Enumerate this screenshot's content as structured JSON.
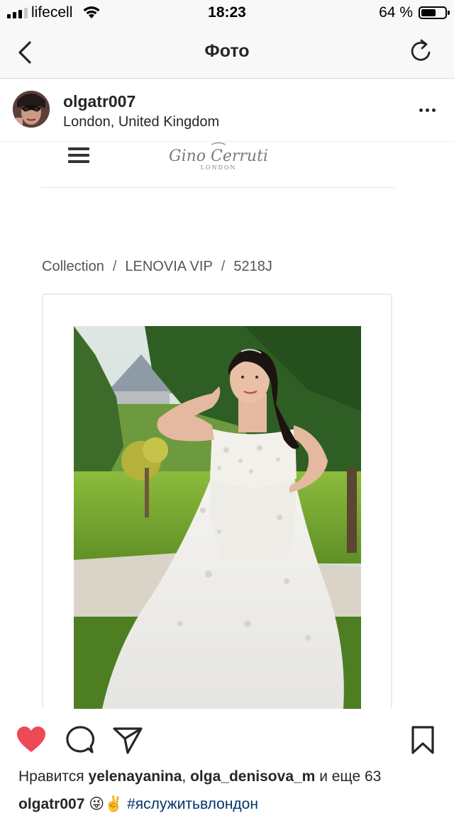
{
  "status_bar": {
    "carrier": "lifecell",
    "time": "18:23",
    "battery_percent": "64 %",
    "battery_level": 0.64,
    "signal_bars_active": 3,
    "signal_bars_total": 4
  },
  "nav": {
    "title": "Фото",
    "back_icon": "chevron-left-icon",
    "refresh_icon": "refresh-icon"
  },
  "post": {
    "username": "olgatr007",
    "location": "London, United Kingdom",
    "more_icon": "more-horizontal-icon"
  },
  "photo_content": {
    "logo_text": "Gino Cerruti",
    "logo_sub": "LONDON",
    "breadcrumb": [
      "Collection",
      "LENOVIA VIP",
      "5218J"
    ],
    "breadcrumb_separator": "/"
  },
  "actions": {
    "like_icon": "heart-filled-icon",
    "comment_icon": "comment-icon",
    "share_icon": "paper-plane-icon",
    "save_icon": "bookmark-icon",
    "like_color": "#ed4956"
  },
  "likes": {
    "prefix": "Нравится",
    "user1": "yelenayanina",
    "comma": ",",
    "user2": "olga_denisova_m",
    "and_text": "и еще 63"
  },
  "caption": {
    "username": "olgatr007",
    "emoji": "😜✌️",
    "hashtag": "#яслужитьвлондон"
  }
}
